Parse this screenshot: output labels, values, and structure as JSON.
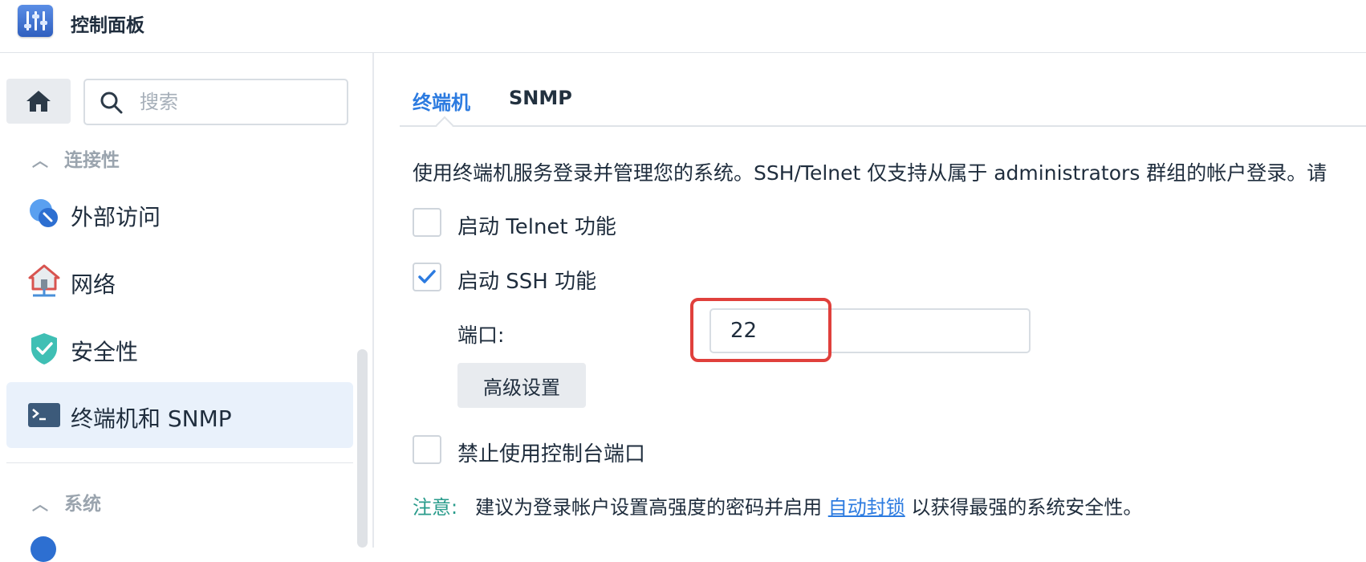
{
  "app": {
    "title": "控制面板"
  },
  "search": {
    "placeholder": "搜索"
  },
  "sidebar": {
    "sections": [
      {
        "label": "连接性"
      },
      {
        "label": "系统"
      }
    ],
    "items": [
      {
        "label": "外部访问",
        "icon": "external-access-icon",
        "active": false
      },
      {
        "label": "网络",
        "icon": "network-house-icon",
        "active": false
      },
      {
        "label": "安全性",
        "icon": "shield-icon",
        "active": false
      },
      {
        "label": "终端机和 SNMP",
        "icon": "terminal-icon",
        "active": true
      }
    ]
  },
  "tabs": [
    {
      "label": "终端机",
      "active": true
    },
    {
      "label": "SNMP",
      "active": false
    }
  ],
  "main": {
    "description": "使用终端机服务登录并管理您的系统。SSH/Telnet 仅支持从属于 administrators 群组的帐户登录。请",
    "telnet": {
      "label": "启动 Telnet 功能",
      "checked": false
    },
    "ssh": {
      "label": "启动 SSH 功能",
      "checked": true
    },
    "port": {
      "label": "端口:",
      "value": "22"
    },
    "advanced_button": "高级设置",
    "console": {
      "label": "禁止使用控制台端口",
      "checked": false
    },
    "note": {
      "label": "注意:",
      "text_before": "建议为登录帐户设置高强度的密码并启用 ",
      "link": "自动封锁",
      "text_after": " 以获得最强的系统安全性。"
    }
  },
  "colors": {
    "accent": "#2c7be0",
    "highlight": "#e0403c",
    "note": "#2a9c8c",
    "active_bg": "#e9f1fb"
  }
}
